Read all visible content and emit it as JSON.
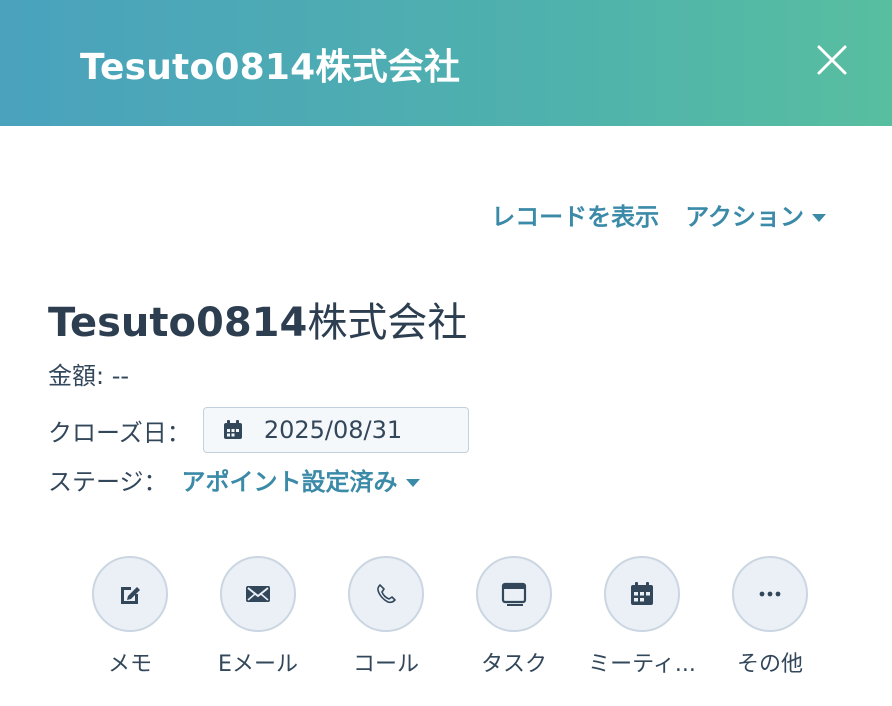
{
  "header": {
    "title": "Tesuto0814株式会社",
    "close_icon": "close-icon"
  },
  "top_links": {
    "view_record": "レコードを表示",
    "actions": "アクション"
  },
  "record": {
    "title_latin": "Tesuto0814",
    "title_jp": "株式会社",
    "amount_text": "金額: --",
    "close_date_label": "クローズ日：",
    "close_date_value": "2025/08/31",
    "stage_label": "ステージ：",
    "stage_value": "アポイント設定済み"
  },
  "actions": [
    {
      "label": "メモ",
      "icon": "edit-icon"
    },
    {
      "label": "Eメール",
      "icon": "email-icon"
    },
    {
      "label": "コール",
      "icon": "phone-icon"
    },
    {
      "label": "タスク",
      "icon": "task-icon"
    },
    {
      "label": "ミーティ...",
      "icon": "calendar-icon"
    },
    {
      "label": "その他",
      "icon": "more-icon"
    }
  ],
  "colors": {
    "header_gradient_start": "#4aa2bd",
    "header_gradient_end": "#58bea0",
    "link": "#3b8aa8",
    "text": "#33475b"
  }
}
